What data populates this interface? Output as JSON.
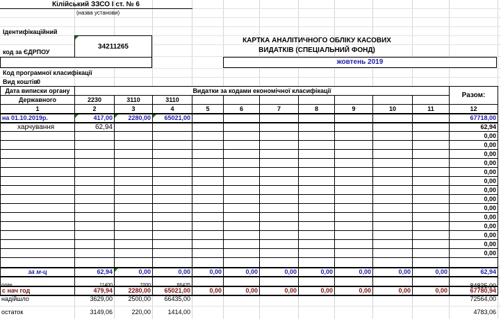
{
  "header": {
    "school": "Кілійський ЗЗСО І ст. № 6",
    "school_caption": "(назва установи)",
    "ident_label": "Ідентифікаційний",
    "edrpou_label": "код за ЄДРПОУ",
    "edrpou_value": "34211265",
    "card_title_line1": "КАРТКА  АНАЛІТИЧНОГО  ОБЛІКУ  КАСОВИХ",
    "card_title_line2": "ВИДАТКІВ (СПЕЦІАЛЬНИЙ ФОНД)",
    "month": "жовтень 2019",
    "program_code_label": "Код програмної класифікації",
    "fund_type_label": "Вид коштів",
    "fund_type_value": "0"
  },
  "table": {
    "date_header_line1": "Дата виписки органу",
    "date_header_line2": "Державного",
    "group_header": "Видатки за кодами економічної класифікації",
    "total_header": "Разом:",
    "codes": [
      "2230",
      "3110",
      "3110"
    ],
    "col_numbers": [
      "1",
      "2",
      "3",
      "4",
      "5",
      "6",
      "7",
      "8",
      "9",
      "10",
      "11",
      "12"
    ],
    "opening_row": {
      "label": "на 01.10.2019р.",
      "values": [
        "417,00",
        "2280,00",
        "65021,00",
        "",
        "",
        "",
        "",
        "",
        "",
        ""
      ],
      "total": "67718,00"
    },
    "entry_row": {
      "label": "харчування",
      "values": [
        "62,94",
        "",
        "",
        "",
        "",
        "",
        "",
        "",
        "",
        ""
      ],
      "total": "62,94"
    },
    "zero_rows_totals": [
      "0,00",
      "0,00",
      "0,00",
      "0,00",
      "0,00",
      "0,00",
      "0,00",
      "0,00",
      "0,00",
      "0,00",
      "0,00",
      "0,00",
      "0,00",
      "0,00"
    ],
    "month_row": {
      "label": "за м-ц",
      "values": [
        "62,94",
        "0,00",
        "0,00",
        "0,00",
        "0,00",
        "0,00",
        "0,00",
        "0,00",
        "0,00",
        "0,00"
      ],
      "total": "62,94"
    },
    "ytd_row": {
      "label": "с нач год",
      "values": [
        "479,94",
        "2280,00",
        "65021,00",
        "0,00",
        "0,00",
        "0,00",
        "0,00",
        "0,00",
        "0,00",
        "0,00"
      ],
      "total": "67780,94"
    }
  },
  "summary": {
    "plan": {
      "label": "план",
      "values": [
        "11400",
        "7000",
        "66435"
      ],
      "total": "84835,00"
    },
    "received": {
      "label": "надійшло",
      "values": [
        "3629,00",
        "2500,00",
        "66435,00"
      ],
      "total": "72564,00"
    },
    "balance": {
      "label": "остаток",
      "values": [
        "3149,06",
        "220,00",
        "1414,00"
      ],
      "total": "4783,06"
    }
  }
}
